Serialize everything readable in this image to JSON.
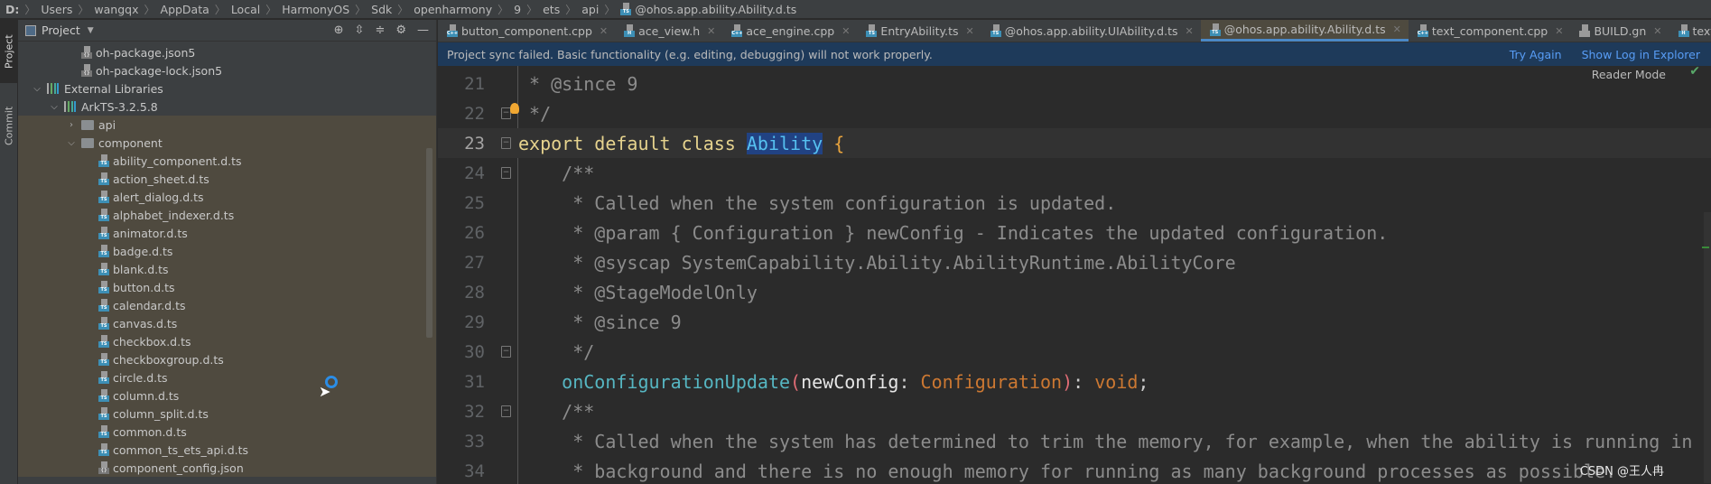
{
  "breadcrumb": [
    "D:",
    "Users",
    "wangqx",
    "AppData",
    "Local",
    "HarmonyOS",
    "Sdk",
    "openharmony",
    "9",
    "ets",
    "api",
    "@ohos.app.ability.Ability.d.ts"
  ],
  "tool_stripe": {
    "project": "Project",
    "commit": "Commit"
  },
  "sidebar": {
    "title": "Project",
    "items": [
      {
        "label": "oh-package.json5",
        "depth": 2,
        "icon": "json",
        "chevron": ""
      },
      {
        "label": "oh-package-lock.json5",
        "depth": 2,
        "icon": "json",
        "chevron": ""
      },
      {
        "label": "External Libraries",
        "depth": 0,
        "icon": "library",
        "chevron": "expanded"
      },
      {
        "label": "ArkTS-3.2.5.8",
        "depth": 1,
        "icon": "library",
        "chevron": "expanded"
      },
      {
        "label": "api",
        "depth": 2,
        "icon": "folder",
        "chevron": "collapsed"
      },
      {
        "label": "component",
        "depth": 2,
        "icon": "folder",
        "chevron": "expanded"
      },
      {
        "label": "ability_component.d.ts",
        "depth": 3,
        "icon": "ts",
        "chevron": ""
      },
      {
        "label": "action_sheet.d.ts",
        "depth": 3,
        "icon": "ts",
        "chevron": ""
      },
      {
        "label": "alert_dialog.d.ts",
        "depth": 3,
        "icon": "ts",
        "chevron": ""
      },
      {
        "label": "alphabet_indexer.d.ts",
        "depth": 3,
        "icon": "ts",
        "chevron": ""
      },
      {
        "label": "animator.d.ts",
        "depth": 3,
        "icon": "ts",
        "chevron": ""
      },
      {
        "label": "badge.d.ts",
        "depth": 3,
        "icon": "ts",
        "chevron": ""
      },
      {
        "label": "blank.d.ts",
        "depth": 3,
        "icon": "ts",
        "chevron": ""
      },
      {
        "label": "button.d.ts",
        "depth": 3,
        "icon": "ts",
        "chevron": ""
      },
      {
        "label": "calendar.d.ts",
        "depth": 3,
        "icon": "ts",
        "chevron": ""
      },
      {
        "label": "canvas.d.ts",
        "depth": 3,
        "icon": "ts",
        "chevron": ""
      },
      {
        "label": "checkbox.d.ts",
        "depth": 3,
        "icon": "ts",
        "chevron": ""
      },
      {
        "label": "checkboxgroup.d.ts",
        "depth": 3,
        "icon": "ts",
        "chevron": ""
      },
      {
        "label": "circle.d.ts",
        "depth": 3,
        "icon": "ts",
        "chevron": ""
      },
      {
        "label": "column.d.ts",
        "depth": 3,
        "icon": "ts",
        "chevron": ""
      },
      {
        "label": "column_split.d.ts",
        "depth": 3,
        "icon": "ts",
        "chevron": ""
      },
      {
        "label": "common.d.ts",
        "depth": 3,
        "icon": "ts",
        "chevron": ""
      },
      {
        "label": "common_ts_ets_api.d.ts",
        "depth": 3,
        "icon": "ts",
        "chevron": ""
      },
      {
        "label": "component_config.json",
        "depth": 3,
        "icon": "json",
        "chevron": ""
      }
    ]
  },
  "tabs": [
    {
      "label": "button_component.cpp",
      "icon": "cpp",
      "active": false
    },
    {
      "label": "ace_view.h",
      "icon": "h",
      "active": false
    },
    {
      "label": "ace_engine.cpp",
      "icon": "cpp",
      "active": false
    },
    {
      "label": "EntryAbility.ts",
      "icon": "ts",
      "active": false
    },
    {
      "label": "@ohos.app.ability.UIAbility.d.ts",
      "icon": "ts",
      "active": false
    },
    {
      "label": "@ohos.app.ability.Ability.d.ts",
      "icon": "ts",
      "active": true
    },
    {
      "label": "text_component.cpp",
      "icon": "cpp",
      "active": false
    },
    {
      "label": "BUILD.gn",
      "icon": "gn",
      "active": false
    },
    {
      "label": "text_style",
      "icon": "h",
      "active": false
    }
  ],
  "banner": {
    "message": "Project sync failed. Basic functionality (e.g. editing, debugging) will not work properly.",
    "try_again": "Try Again",
    "show_log": "Show Log in Explorer"
  },
  "editor": {
    "reader_mode": "Reader Mode",
    "current_line": 23,
    "lines": [
      {
        "n": "21",
        "fold": "",
        "tokens": [
          {
            "t": " * @since 9",
            "k": "comment"
          }
        ]
      },
      {
        "n": "22",
        "fold": "end",
        "tokens": [
          {
            "t": " */",
            "k": "comment"
          }
        ]
      },
      {
        "n": "23",
        "fold": "start",
        "tokens": [
          {
            "t": "export default class ",
            "k": "kw"
          },
          {
            "t": "Ability",
            "k": "cls"
          },
          {
            "t": " {",
            "k": "brace"
          }
        ]
      },
      {
        "n": "24",
        "fold": "start",
        "tokens": [
          {
            "t": "    /**",
            "k": "comment"
          }
        ]
      },
      {
        "n": "25",
        "fold": "",
        "tokens": [
          {
            "t": "     * Called when the system configuration is updated.",
            "k": "comment"
          }
        ]
      },
      {
        "n": "26",
        "fold": "",
        "tokens": [
          {
            "t": "     * @param { Configuration } newConfig - Indicates the updated configuration.",
            "k": "comment"
          }
        ]
      },
      {
        "n": "27",
        "fold": "",
        "tokens": [
          {
            "t": "     * @syscap SystemCapability.Ability.AbilityRuntime.AbilityCore",
            "k": "comment"
          }
        ]
      },
      {
        "n": "28",
        "fold": "",
        "tokens": [
          {
            "t": "     * @StageModelOnly",
            "k": "comment"
          }
        ]
      },
      {
        "n": "29",
        "fold": "",
        "tokens": [
          {
            "t": "     * @since 9",
            "k": "comment"
          }
        ]
      },
      {
        "n": "30",
        "fold": "end",
        "tokens": [
          {
            "t": "     */",
            "k": "comment"
          }
        ]
      },
      {
        "n": "31",
        "fold": "",
        "tokens": [
          {
            "t": "    onConfigurationUpdate",
            "k": "fn"
          },
          {
            "t": "(",
            "k": "paren"
          },
          {
            "t": "newConfig",
            "k": "ident"
          },
          {
            "t": ": ",
            "k": "punc"
          },
          {
            "t": "Configuration",
            "k": "type"
          },
          {
            "t": ")",
            "k": "paren"
          },
          {
            "t": ": ",
            "k": "punc"
          },
          {
            "t": "void",
            "k": "type"
          },
          {
            "t": ";",
            "k": "punc"
          }
        ]
      },
      {
        "n": "32",
        "fold": "start",
        "tokens": [
          {
            "t": "    /**",
            "k": "comment"
          }
        ]
      },
      {
        "n": "33",
        "fold": "",
        "tokens": [
          {
            "t": "     * Called when the system has determined to trim the memory, for example, when the ability is running in the",
            "k": "comment"
          }
        ]
      },
      {
        "n": "34",
        "fold": "",
        "tokens": [
          {
            "t": "     * background and there is no enough memory for running as many background processes as possible.",
            "k": "comment"
          }
        ]
      }
    ]
  },
  "watermark": "CSDN @王人冉",
  "colors": {
    "accent": "#4a88c7",
    "banner_bg": "#1e3a5a",
    "link": "#589df6",
    "editor_bg": "#2b2b2b",
    "sidebar_bg": "#3c3f41",
    "scope_bg": "#4f4a3f"
  }
}
